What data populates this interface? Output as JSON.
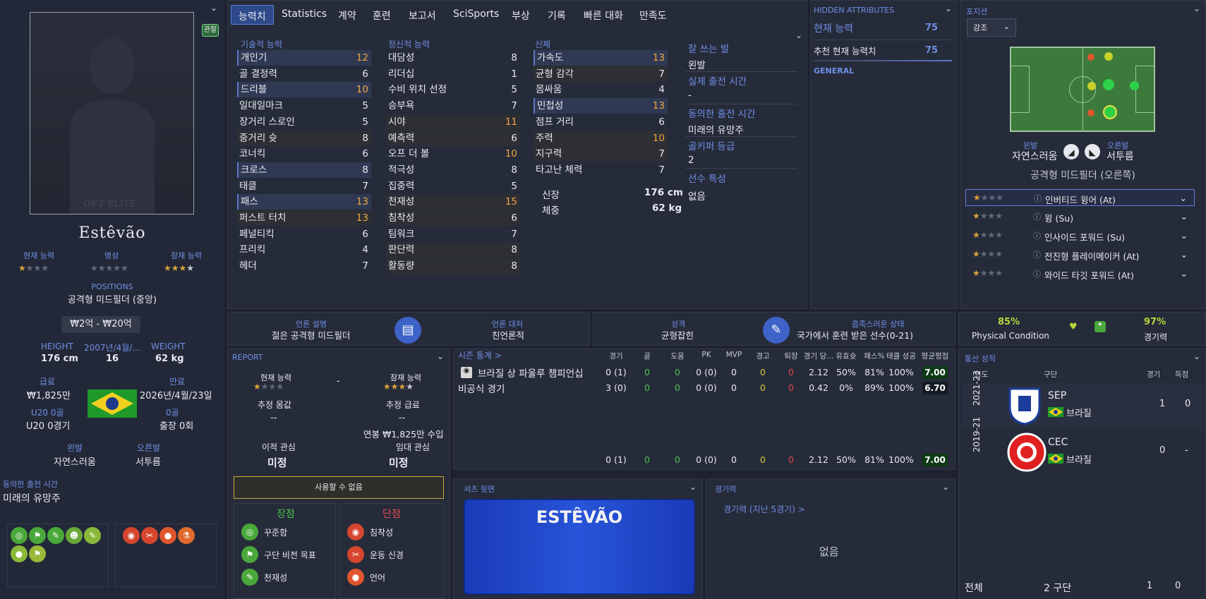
{
  "player": {
    "name": "Estêvão",
    "view_btn": "관찰",
    "ca_label": "현재 능력",
    "rep_label": "명성",
    "pa_label": "잠재 능력",
    "positions_label": "POSITIONS",
    "position": "공격형 미드필더 (중앙)",
    "value": "₩2억 - ₩20억",
    "height_label": "HEIGHT",
    "height": "176 cm",
    "dob_label": "2007년/4월/...",
    "age": "16",
    "weight_label": "WEIGHT",
    "weight": "62 kg",
    "wage_label": "급료",
    "wage": "₩1,825만",
    "expiry_label": "만료",
    "expiry": "2026년/4월/23일",
    "u20_label": "U20 0골",
    "u20_value": "U20 0경기",
    "goals_label": "0골",
    "apps_value": "출장 0회",
    "left_foot_label": "왼발",
    "left_foot": "자연스러움",
    "right_foot_label": "오른발",
    "right_foot": "서투름",
    "playing_time_label": "동의한 출전 시간",
    "playing_time": "미래의 유망주",
    "watermark": "OPZ ELITE"
  },
  "tabs": [
    "능력치",
    "Statistics",
    "계약",
    "훈련",
    "보고서",
    "SciSports",
    "부상",
    "기록",
    "빠른 대화",
    "만족도"
  ],
  "attributes": {
    "technical_title": "기술적 능력",
    "mental_title": "정신적 능력",
    "physical_title": "신체",
    "technical": [
      [
        "개인기",
        "12"
      ],
      [
        "골 결정력",
        "6"
      ],
      [
        "드리블",
        "10"
      ],
      [
        "일대일마크",
        "5"
      ],
      [
        "장거리 스로인",
        "5"
      ],
      [
        "중거리 슛",
        "8"
      ],
      [
        "코너킥",
        "6"
      ],
      [
        "크로스",
        "8"
      ],
      [
        "태클",
        "7"
      ],
      [
        "패스",
        "13"
      ],
      [
        "퍼스트 터치",
        "13"
      ],
      [
        "페널티킥",
        "6"
      ],
      [
        "프리킥",
        "4"
      ],
      [
        "헤더",
        "7"
      ]
    ],
    "mental": [
      [
        "대담성",
        "8"
      ],
      [
        "리더십",
        "1"
      ],
      [
        "수비 위치 선정",
        "5"
      ],
      [
        "승부욕",
        "7"
      ],
      [
        "시야",
        "11"
      ],
      [
        "예측력",
        "6"
      ],
      [
        "오프 더 볼",
        "10"
      ],
      [
        "적극성",
        "8"
      ],
      [
        "집중력",
        "5"
      ],
      [
        "천재성",
        "15"
      ],
      [
        "침착성",
        "6"
      ],
      [
        "팀워크",
        "7"
      ],
      [
        "판단력",
        "8"
      ],
      [
        "활동량",
        "8"
      ]
    ],
    "physical": [
      [
        "가속도",
        "13"
      ],
      [
        "균형 감각",
        "7"
      ],
      [
        "몸싸움",
        "4"
      ],
      [
        "민첩성",
        "13"
      ],
      [
        "점프 거리",
        "6"
      ],
      [
        "주력",
        "10"
      ],
      [
        "지구력",
        "7"
      ],
      [
        "타고난 체력",
        "7"
      ]
    ],
    "height_label": "신장",
    "height": "176 cm",
    "weight_label": "체중",
    "weight": "62 kg"
  },
  "side_info": {
    "foot_label": "잘 쓰는 발",
    "foot": "왼발",
    "actual_time_label": "실제 출전 시간",
    "actual_time": "-",
    "agreed_label": "동의한 출전 시간",
    "agreed": "미래의 유망주",
    "gk_label": "골키퍼 등급",
    "gk": "2",
    "traits_label": "선수 특성",
    "traits": "없음"
  },
  "hidden": {
    "title": "HIDDEN ATTRIBUTES",
    "ca_label": "현재 능력",
    "ca": "75",
    "rec_label": "추천 현재 능력치",
    "rec": "75",
    "general": "GENERAL"
  },
  "position_panel": {
    "title": "포지션",
    "select": "강조",
    "left_label": "왼발",
    "left": "자연스러움",
    "right_label": "오른발",
    "right": "서투름",
    "role": "공격형 미드필더 (오른쪽)",
    "roles": [
      "인버티드 윙어 (At)",
      "윙 (Su)",
      "인사이드 포워드 (Su)",
      "전진형 플레이메이커 (At)",
      "와이드 타깃 포워드 (At)"
    ]
  },
  "media": {
    "desc_label": "언론 설명",
    "desc": "젊은 공격형 미드필더",
    "handle_label": "언론 대처",
    "handle": "친언론적",
    "pers_label": "성격",
    "pers": "균형잡힌",
    "happy_label": "흡족스러운 상태",
    "happy": "국가에서 훈련 받은 선수(0-21)"
  },
  "condition": {
    "phys": "85%",
    "phys_label": "Physical Condition",
    "sharp": "97%",
    "sharp_label": "경기력"
  },
  "report": {
    "title": "REPORT",
    "ca_label": "현재 능력",
    "dash": "-",
    "pa_label": "잠재 능력",
    "fee_label": "추정 몸값",
    "fee": "--",
    "wage_label": "추정 급료",
    "wage": "--",
    "wage_note": "연봉 ₩1,825만 수입",
    "transfer_label": "이적 관심",
    "transfer": "미정",
    "loan_label": "임대 관심",
    "loan": "미정",
    "unavailable": "사용할 수 없음",
    "strengths": "장점",
    "weaknesses": "단점",
    "strength_list": [
      "꾸준함",
      "구단 비전 목표",
      "천재성"
    ],
    "weakness_list": [
      "침착성",
      "운동 신경",
      "언어"
    ]
  },
  "season": {
    "title": "시즌 통계 >",
    "headers": [
      "경기",
      "골",
      "도움",
      "PK",
      "MVP",
      "경고",
      "퇴장",
      "경기 당...",
      "유효슛",
      "패스%",
      "태클 성공",
      "평균평점"
    ],
    "rows": [
      {
        "name": "브라질 상 파울루 챔피언십",
        "vals": [
          "0 (1)",
          "0",
          "0",
          "0 (0)",
          "0",
          "0",
          "0",
          "2.12",
          "50%",
          "81%",
          "100%"
        ],
        "rating": "7.00"
      },
      {
        "name": "비공식 경기",
        "vals": [
          "3 (0)",
          "0",
          "0",
          "0 (0)",
          "0",
          "0",
          "0",
          "0.42",
          "0%",
          "89%",
          "100%"
        ],
        "rating": "6.70"
      }
    ],
    "total": {
      "vals": [
        "0 (1)",
        "0",
        "0",
        "0 (0)",
        "0",
        "0",
        "0",
        "2.12",
        "50%",
        "81%",
        "100%"
      ],
      "rating": "7.00"
    }
  },
  "shirt": {
    "title": "셔츠 뒷면",
    "name": "ESTÊVÃO"
  },
  "form": {
    "title": "경기력",
    "link": "경기력 (지난 5경기) >",
    "empty": "없음"
  },
  "career": {
    "title": "통산 성적",
    "h_year": "연도",
    "h_club": "구단",
    "h_apps": "경기",
    "h_goals": "득점",
    "rows": [
      {
        "year": "2021-23",
        "club": "SEP",
        "nation": "브라질",
        "apps": "1",
        "goals": "0"
      },
      {
        "year": "2019-21",
        "club": "CEC",
        "nation": "브라질",
        "apps": "0",
        "goals": "-"
      }
    ],
    "total_label": "전체",
    "total_clubs": "2 구단",
    "total_apps": "1",
    "total_goals": "0"
  },
  "colors": {
    "accent": "#6f8fe6",
    "highlight": "#f0a640",
    "bg": "#1e2230"
  }
}
